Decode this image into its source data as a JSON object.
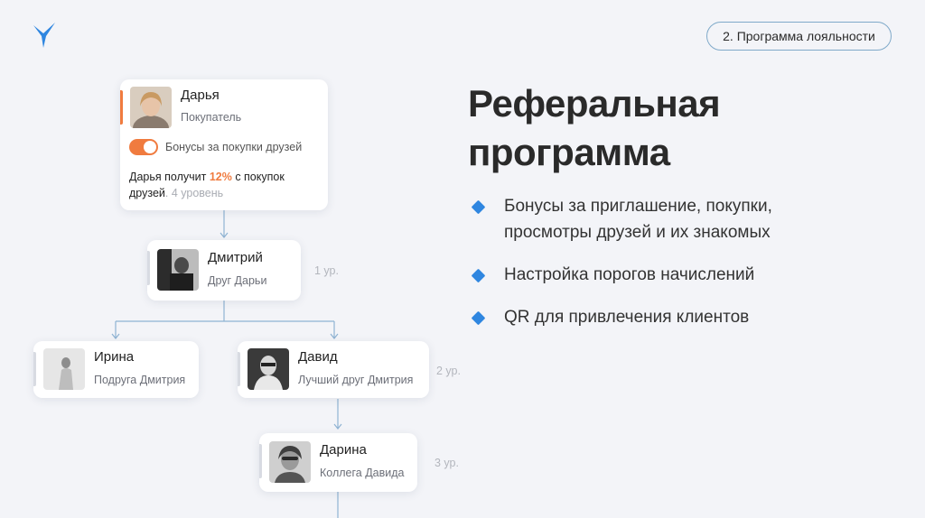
{
  "brand": {
    "logo_icon": "bird-logo-icon",
    "accent": "#2f86e0",
    "highlight": "#f07b3f"
  },
  "section": {
    "label": "2. Программа лояльности"
  },
  "heading": {
    "line1": "Реферальная",
    "line2": "программа"
  },
  "bullets": [
    {
      "text": "Бонусы за приглашение, покупки, просмотры друзей и их знакомых"
    },
    {
      "text": "Настройка порогов начислений"
    },
    {
      "text": "QR для привлечения клиентов"
    }
  ],
  "tree": {
    "root": {
      "name": "Дарья",
      "role": "Покупатель",
      "toggle_label": "Бонусы за покупки друзей",
      "toggle_on": true,
      "info_prefix": "Дарья получит ",
      "info_percent": "12%",
      "info_suffix": " с покупок друзей",
      "info_level": ". 4 уровень"
    },
    "level1": {
      "name": "Дмитрий",
      "role": "Друг Дарьи",
      "level": "1 ур."
    },
    "level2": [
      {
        "name": "Ирина",
        "role": "Подруга Дмитрия"
      },
      {
        "name": "Давид",
        "role": "Лучший друг Дмитрия"
      }
    ],
    "level2_label": "2 ур.",
    "level3": {
      "name": "Дарина",
      "role": "Коллега Давида",
      "level": "3 ур."
    }
  }
}
